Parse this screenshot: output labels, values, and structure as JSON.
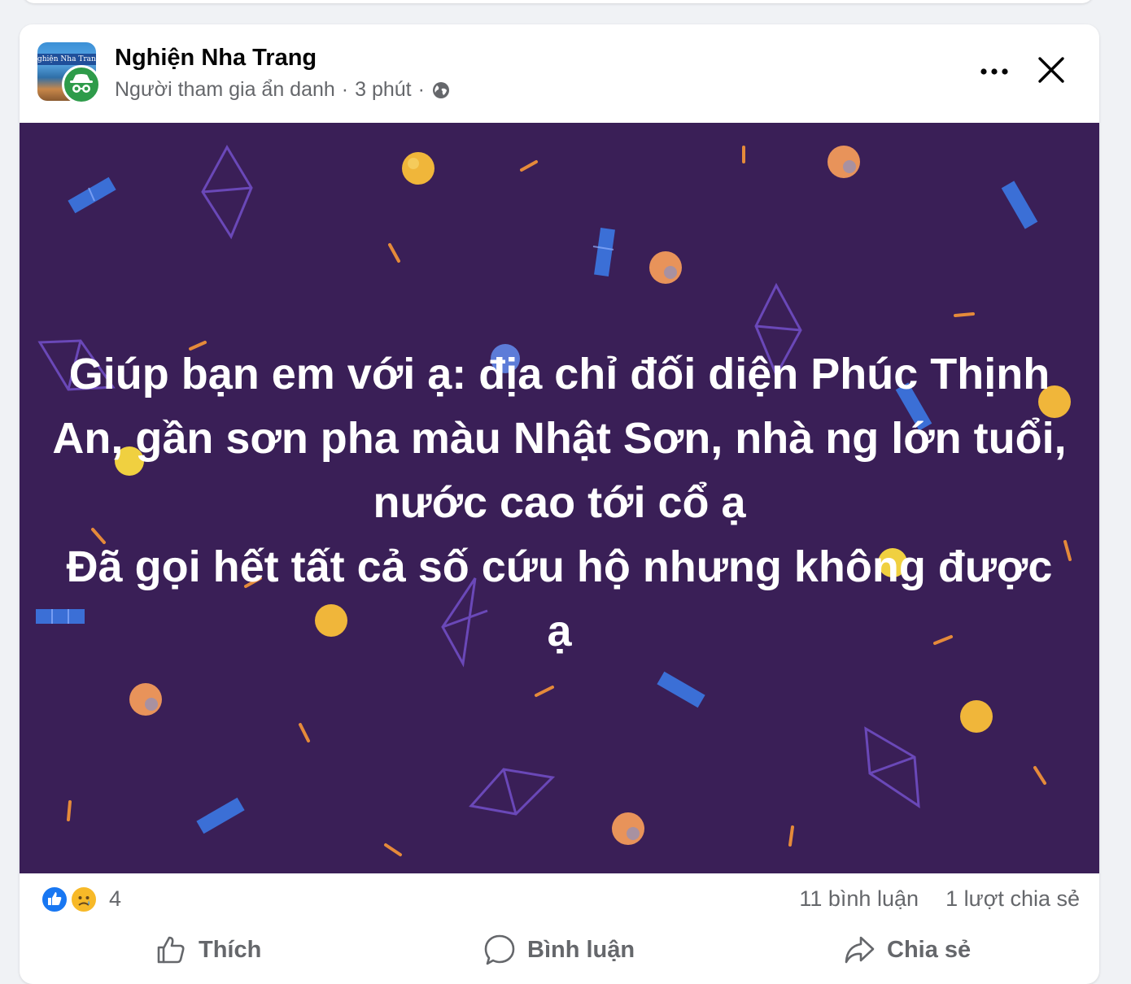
{
  "post": {
    "group_name": "Nghiện Nha Trang",
    "avatar_banner_text": "ghiện Nha Trang",
    "author": "Người tham gia ẩn danh",
    "separator": "·",
    "time": "3 phút",
    "audience_icon": "globe-icon",
    "more_icon": "more-horizontal-icon",
    "close_icon": "close-icon",
    "background_color": "#3a1f57",
    "text": "Giúp bạn em với ạ: địa chỉ đối diện Phúc Thịnh An, gần sơn pha màu Nhật Sơn, nhà ng lớn tuổi, nước cao tới cổ ạ\nĐã gọi hết tất cả số cứu hộ nhưng không được ạ"
  },
  "stats": {
    "reaction_icons": [
      "like-reaction-icon",
      "sad-reaction-icon"
    ],
    "reaction_count": "4",
    "comments": "11 bình luận",
    "shares": "1 lượt chia sẻ"
  },
  "actions": {
    "like_label": "Thích",
    "comment_label": "Bình luận",
    "share_label": "Chia sẻ"
  },
  "colors": {
    "like_blue": "#1877f2",
    "secondary_text": "#65676b",
    "anon_green": "#2e9b4a"
  }
}
